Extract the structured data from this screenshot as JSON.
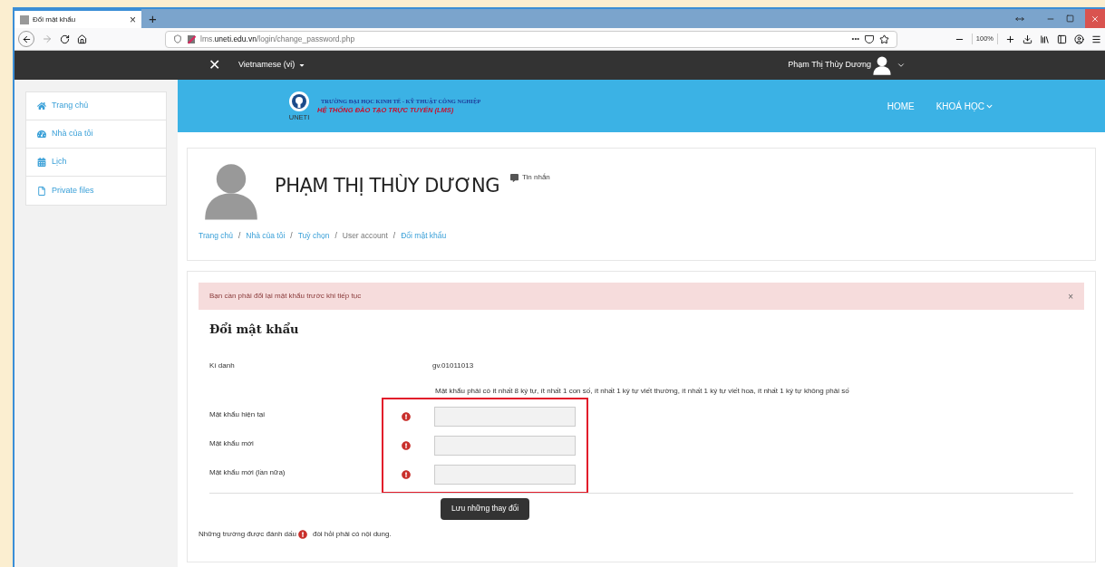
{
  "browser": {
    "tab": {
      "title": "Đổi mật khẩu",
      "close": "×"
    },
    "new_tab": "+",
    "url": {
      "prefix": "lms.",
      "domain": "uneti.edu.vn",
      "path": "/login/change_password.php"
    },
    "page_actions": "•••",
    "zoom": "100%"
  },
  "navbar": {
    "close": "✕",
    "language": "Vietnamese (vi)",
    "user": "Phạm Thị Thùy Dương"
  },
  "sidebar": {
    "items": [
      {
        "label": "Trang chủ"
      },
      {
        "label": "Nhà của tôi"
      },
      {
        "label": "Lịch"
      },
      {
        "label": "Private files"
      }
    ]
  },
  "header": {
    "logo_caption": "UNETI",
    "school": "TRƯỜNG ĐẠI HỌC KINH TẾ - KỸ THUẬT CÔNG NGHIỆP",
    "system": "HỆ THỐNG ĐÀO TẠO TRỰC TUYẾN (LMS)",
    "nav": [
      {
        "label": "HOME",
        "dropdown": false
      },
      {
        "label": "KHOÁ HỌC",
        "dropdown": true
      }
    ]
  },
  "profile": {
    "name": "PHẠM THỊ THÙY DƯƠNG",
    "message": "Tin nhắn",
    "breadcrumb_separator": "/",
    "breadcrumb": [
      {
        "label": "Trang chủ",
        "link": true
      },
      {
        "label": "Nhà của tôi",
        "link": true
      },
      {
        "label": "Tuỳ chọn",
        "link": true
      },
      {
        "label": "User account",
        "link": false
      },
      {
        "label": "Đổi mật khẩu",
        "link": true
      }
    ]
  },
  "alert": {
    "text": "Bạn cần phải đổi lại mật khẩu trước khi tiếp tục",
    "close": "×"
  },
  "form": {
    "title": "Đổi mật khẩu",
    "username_label": "Kí danh",
    "username": "gv.01011013",
    "policy": "Mật khẩu phải có ít nhất 8 ký tự, ít nhất 1 con số, ít nhất 1 ký tự viết thường, ít nhất 1 ký tự viết hoa, ít nhất 1 ký tự không phải số",
    "highlighted": true,
    "fields": [
      {
        "label": "Mật khẩu hiện tại",
        "required": true
      },
      {
        "label": "Mật khẩu mới",
        "required": true
      },
      {
        "label": "Mật khẩu mới (lần nữa)",
        "required": true
      }
    ],
    "submit": "Lưu những thay đổi",
    "note_before": "Những trường được đánh dấu",
    "note_after": "đòi hỏi phải có nội dung."
  }
}
